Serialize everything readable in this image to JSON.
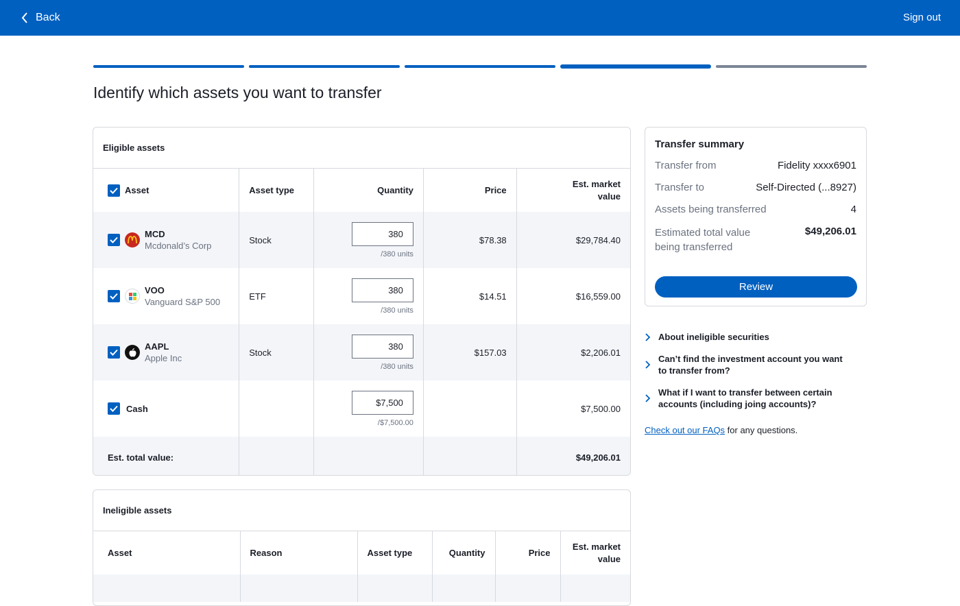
{
  "header": {
    "back_label": "Back",
    "signout_label": "Sign out"
  },
  "progress": {
    "steps_total": 5,
    "current_step": 4
  },
  "page_title": "Identify which assets you want to transfer",
  "eligible": {
    "title": "Eligible assets",
    "columns": {
      "asset": "Asset",
      "asset_type": "Asset type",
      "quantity": "Quantity",
      "price": "Price",
      "market_value": "Est. market value"
    },
    "rows": [
      {
        "ticker": "MCD",
        "name": "Mcdonald’s Corp",
        "type": "Stock",
        "qty": "380",
        "units": "/380 units",
        "price": "$78.38",
        "value": "$29,784.40"
      },
      {
        "ticker": "VOO",
        "name": "Vanguard S&P 500",
        "type": "ETF",
        "qty": "380",
        "units": "/380 units",
        "price": "$14.51",
        "value": "$16,559.00"
      },
      {
        "ticker": "AAPL",
        "name": "Apple Inc",
        "type": "Stock",
        "qty": "380",
        "units": "/380 units",
        "price": "$157.03",
        "value": "$2,206.01"
      },
      {
        "ticker": "Cash",
        "name": "",
        "type": "",
        "qty": "$7,500",
        "units": "/$7,500.00",
        "price": "",
        "value": "$7,500.00"
      }
    ],
    "total_label": "Est. total value:",
    "total_value": "$49,206.01"
  },
  "ineligible": {
    "title": "Ineligible assets",
    "columns": {
      "asset": "Asset",
      "reason": "Reason",
      "asset_type": "Asset type",
      "quantity": "Quantity",
      "price": "Price",
      "market_value": "Est. market value"
    }
  },
  "summary": {
    "title": "Transfer summary",
    "from_label": "Transfer from",
    "from_value": "Fidelity xxxx6901",
    "to_label": "Transfer to",
    "to_value": "Self-Directed (...8927)",
    "count_label": "Assets being transferred",
    "count_value": "4",
    "total_label": "Estimated total value being transferred",
    "total_value": "$49,206.01",
    "review_label": "Review"
  },
  "faqs": [
    "About ineligible securities",
    "Can’t find the investment account you want to transfer from?",
    "What if I want to transfer between certain accounts (including joing accounts)?"
  ],
  "faq_link": {
    "link_text": "Check out our FAQs",
    "suffix": " for any questions."
  },
  "colors": {
    "brand": "#0060c0",
    "todo": "#7b8594"
  }
}
